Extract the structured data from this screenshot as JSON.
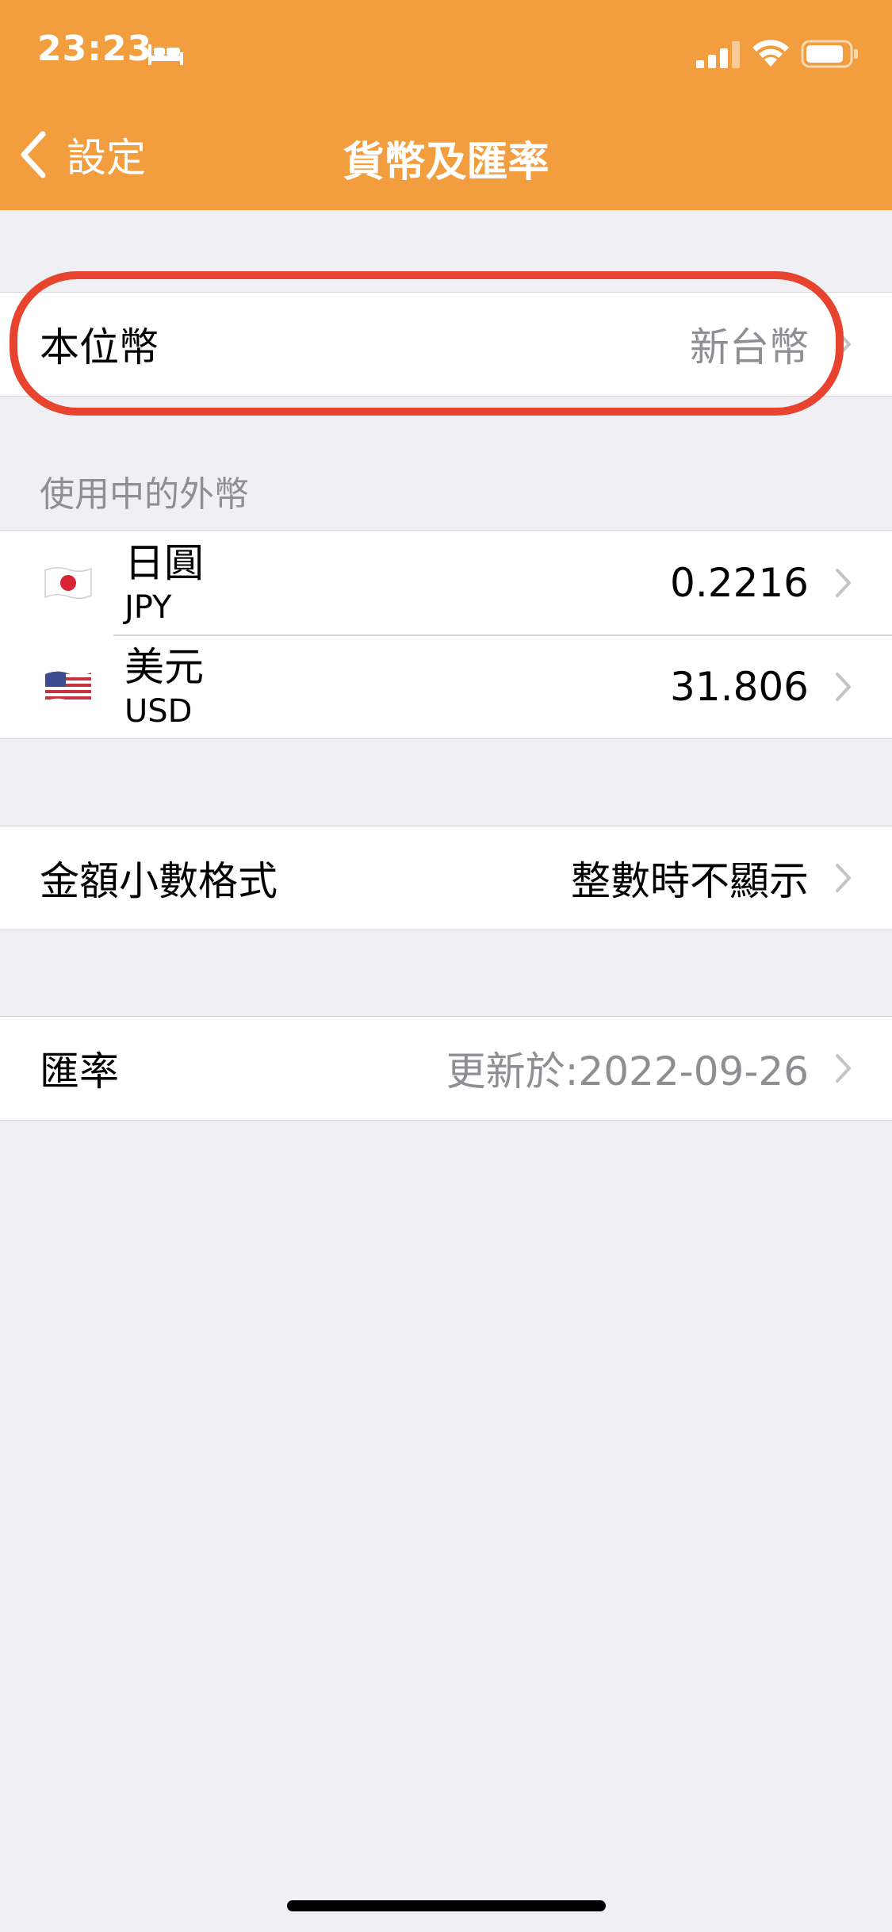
{
  "status_bar": {
    "time": "23:23"
  },
  "nav": {
    "back_label": "設定",
    "title": "貨幣及匯率"
  },
  "base_currency": {
    "label": "本位幣",
    "value": "新台幣"
  },
  "foreign_section": {
    "header": "使用中的外幣",
    "items": [
      {
        "name": "日圓",
        "code": "JPY",
        "rate": "0.2216",
        "flag": "japan-flag"
      },
      {
        "name": "美元",
        "code": "USD",
        "rate": "31.806",
        "flag": "us-flag"
      }
    ]
  },
  "decimal_format": {
    "label": "金額小數格式",
    "value": "整數時不顯示"
  },
  "exchange_rate": {
    "label": "匯率",
    "value": "更新於:2022-09-26"
  },
  "colors": {
    "header": "#f29d3e",
    "highlight": "#e8432f",
    "background": "#efeff4"
  }
}
